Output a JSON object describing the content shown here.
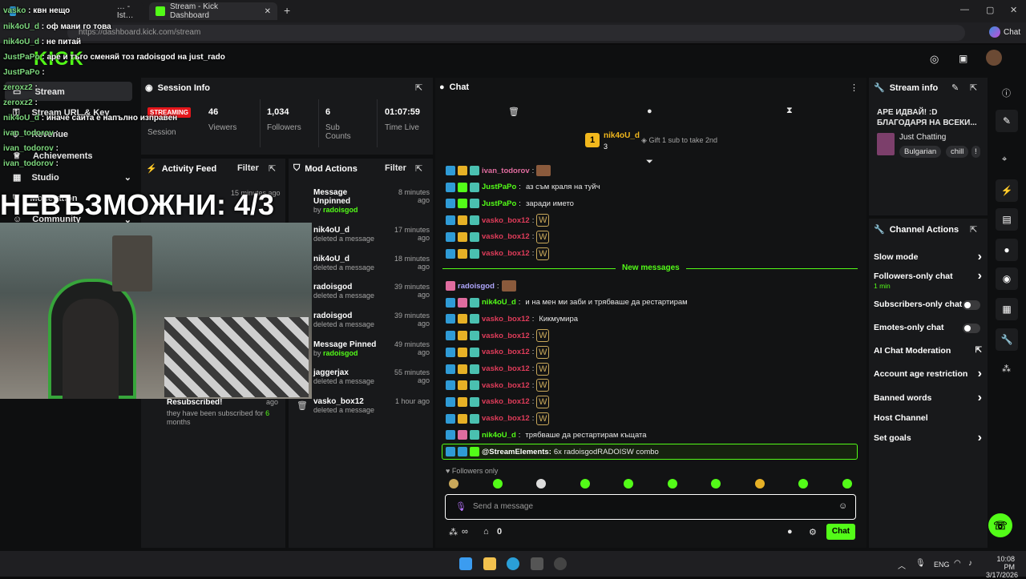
{
  "browser": {
    "tab1_title": "Stream - Kick Dashboard",
    "tab0_title": "… - Ist…",
    "url": "https://dashboard.kick.com/stream",
    "copilot_label": "Chat"
  },
  "overlay": {
    "big_text": "НЕВЪЗМОЖНИ: 4/3",
    "messages": [
      {
        "user": "vasko",
        "text": "квн нещо"
      },
      {
        "user": "nik4oU_d",
        "text": "оф мани го това"
      },
      {
        "user": "nik4oU_d",
        "text": "не питай"
      },
      {
        "user": "JustPaPo",
        "text": "аре и тъго сменяй тоз radoisgod на just_rado"
      },
      {
        "user": "JustPaPo",
        "text": ""
      },
      {
        "user": "zeroxz2",
        "text": ""
      },
      {
        "user": "zeroxz2",
        "text": ""
      },
      {
        "user": "nik4oU_d",
        "text": "иначе сайта е напълно изправен"
      },
      {
        "user": "ivan_todorov",
        "text": ""
      },
      {
        "user": "ivan_todorov",
        "text": ""
      },
      {
        "user": "ivan_todorov",
        "text": ""
      }
    ]
  },
  "sidebar": {
    "items": [
      {
        "label": "Stream",
        "icon": "stream-icon"
      },
      {
        "label": "Stream URL & Key",
        "icon": "key-icon"
      },
      {
        "label": "Revenue",
        "icon": "revenue-icon"
      },
      {
        "label": "Achievements",
        "icon": "trophy-icon"
      },
      {
        "label": "Studio",
        "icon": "studio-icon"
      },
      {
        "label": "Moderation",
        "icon": "shield-icon"
      },
      {
        "label": "Community",
        "icon": "community-icon"
      }
    ]
  },
  "session": {
    "title": "Session Info",
    "status": "STREAMING",
    "session_label": "Session",
    "stats": [
      {
        "value": "46",
        "label": "Viewers"
      },
      {
        "value": "1,034",
        "label": "Followers"
      },
      {
        "value": "6",
        "label": "Sub Counts"
      },
      {
        "value": "01:07:59",
        "label": "Time Live"
      }
    ]
  },
  "activity": {
    "title": "Activity Feed",
    "filter": "Filter",
    "item_time": "15 minutes ago",
    "resub_title": "Resubscribed!",
    "resub_time": "ago",
    "resub_text": "they have been subscribed for",
    "resub_months": "6",
    "resub_unit": "months"
  },
  "mod": {
    "title": "Mod Actions",
    "filter": "Filter",
    "rows": [
      {
        "title": "Message Unpinned",
        "sub_prefix": "by",
        "sub": "radoisgod",
        "time": "8 minutes ago"
      },
      {
        "title": "nik4oU_d",
        "sub_prefix": "",
        "sub": "deleted a message",
        "time": "17 minutes ago"
      },
      {
        "title": "nik4oU_d",
        "sub_prefix": "",
        "sub": "deleted a message",
        "time": "18 minutes ago"
      },
      {
        "title": "radoisgod",
        "sub_prefix": "",
        "sub": "deleted a message",
        "time": "39 minutes ago"
      },
      {
        "title": "radoisgod",
        "sub_prefix": "",
        "sub": "deleted a message",
        "time": "39 minutes ago"
      },
      {
        "title": "Message Pinned",
        "sub_prefix": "by",
        "sub": "radoisgod",
        "time": "49 minutes ago"
      },
      {
        "title": "jaggerjax",
        "sub_prefix": "",
        "sub": "deleted a message",
        "time": "55 minutes ago"
      },
      {
        "title": "vasko_box12",
        "sub_prefix": "",
        "sub": "deleted a message",
        "time": "1 hour ago"
      }
    ]
  },
  "chat": {
    "title": "Chat",
    "top_gifter": "nik4oU_d",
    "top_gifter_count": "3",
    "top_rank": "1",
    "gift_text": "Gift 1 sub to take 2nd",
    "new_messages": "New messages",
    "lines_before": [
      {
        "user": "ivan_todorov",
        "text": "",
        "color": "#e06c9f"
      },
      {
        "user": "JustPaPo",
        "text": "аз съм краля на туйч",
        "color": "#53fc18"
      },
      {
        "user": "JustPaPo",
        "text": "заради името",
        "color": "#53fc18"
      },
      {
        "user": "vasko_box12",
        "text": "",
        "color": "#e03c5a"
      },
      {
        "user": "vasko_box12",
        "text": "",
        "color": "#e03c5a"
      },
      {
        "user": "vasko_box12",
        "text": "",
        "color": "#e03c5a"
      }
    ],
    "lines_after": [
      {
        "user": "radoisgod",
        "text": "",
        "color": "#b0a7ff"
      },
      {
        "user": "nik4oU_d",
        "text": "и на мен ми заби и трябваше да рестартирам",
        "color": "#53fc18"
      },
      {
        "user": "vasko_box12",
        "text": "Кикмумира",
        "color": "#e03c5a"
      },
      {
        "user": "vasko_box12",
        "text": "",
        "color": "#e03c5a"
      },
      {
        "user": "vasko_box12",
        "text": "",
        "color": "#e03c5a"
      },
      {
        "user": "vasko_box12",
        "text": "",
        "color": "#e03c5a"
      },
      {
        "user": "vasko_box12",
        "text": "",
        "color": "#e03c5a"
      },
      {
        "user": "vasko_box12",
        "text": "",
        "color": "#e03c5a"
      },
      {
        "user": "vasko_box12",
        "text": "",
        "color": "#e03c5a"
      },
      {
        "user": "nik4oU_d",
        "text": "трябваше да рестартирам къщата",
        "color": "#53fc18"
      }
    ],
    "highlight_user": "@StreamElements:",
    "highlight_text": "6x radoisgodRADOISW combo",
    "followers_only": "Followers only",
    "input_placeholder": "Send a message",
    "points": "0",
    "send": "Chat"
  },
  "stream_info": {
    "title": "Stream info",
    "stream_title": "АРЕ ИДВАЙ! :D БЛАГОДАРЯ НА ВСЕКИ...",
    "category": "Just Chatting",
    "tags": [
      "Bulgarian",
      "chill",
      "!"
    ]
  },
  "channel_actions": {
    "title": "Channel Actions",
    "items": [
      {
        "label": "Slow mode",
        "kind": "chevron",
        "sub": ""
      },
      {
        "label": "Followers-only chat",
        "kind": "chevron",
        "sub": "1 min"
      },
      {
        "label": "Subscribers-only chat",
        "kind": "toggle",
        "sub": ""
      },
      {
        "label": "Emotes-only chat",
        "kind": "toggle",
        "sub": ""
      },
      {
        "label": "AI Chat Moderation",
        "kind": "external",
        "sub": ""
      },
      {
        "label": "Account age restriction",
        "kind": "chevron",
        "sub": ""
      },
      {
        "label": "Banned words",
        "kind": "chevron",
        "sub": ""
      },
      {
        "label": "Host Channel",
        "kind": "none",
        "sub": ""
      },
      {
        "label": "Set goals",
        "kind": "chevron",
        "sub": ""
      }
    ]
  },
  "taskbar": {
    "lang": "ENG",
    "time": "10:08 PM",
    "date": "3/17/2026"
  }
}
